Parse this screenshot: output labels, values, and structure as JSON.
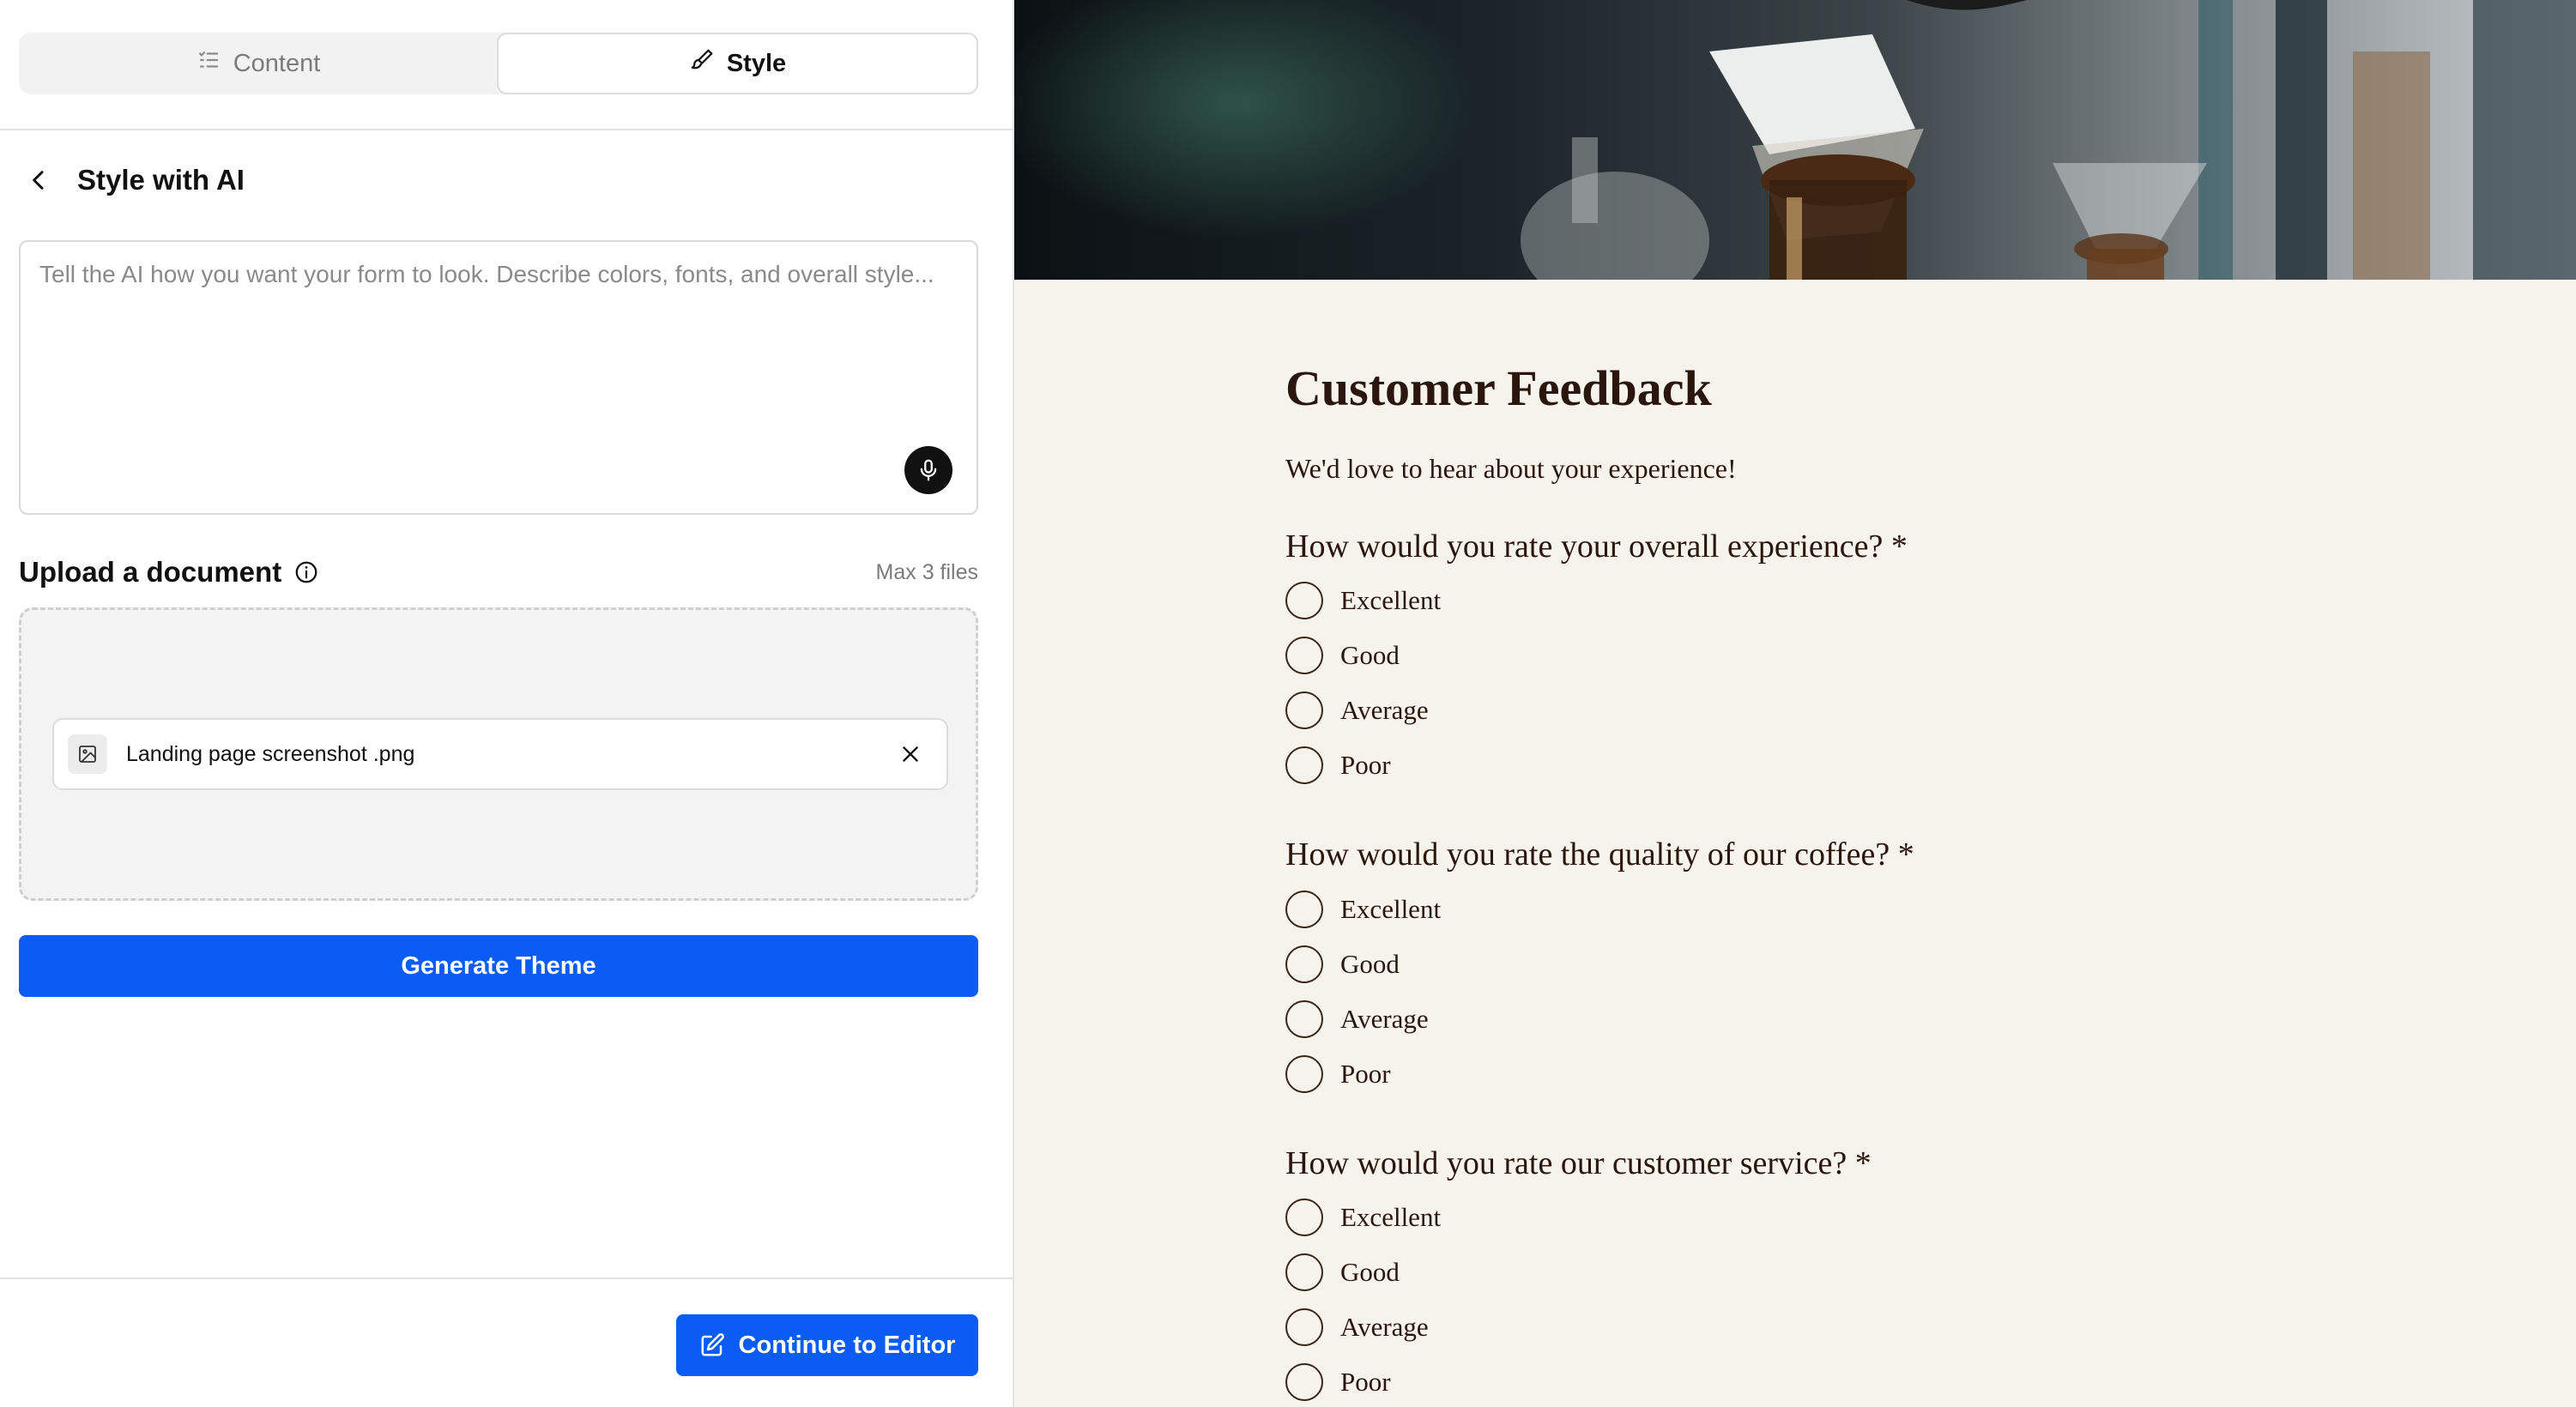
{
  "tabs": [
    {
      "label": "Content",
      "icon": "list-icon",
      "active": false
    },
    {
      "label": "Style",
      "icon": "brush-icon",
      "active": true
    }
  ],
  "panel": {
    "title": "Style with AI",
    "prompt_placeholder": "Tell the AI how you want your form to look. Describe colors, fonts, and overall style...",
    "prompt_value": ""
  },
  "upload": {
    "label": "Upload a document",
    "max_files": "Max 3 files",
    "files": [
      {
        "name": "Landing page screenshot .png",
        "icon": "image-icon"
      }
    ]
  },
  "actions": {
    "generate_label": "Generate Theme",
    "continue_label": "Continue to Editor"
  },
  "colors": {
    "accent": "#0a5cf5",
    "preview_background": "#f6f2ec",
    "preview_text": "#2a160c"
  },
  "preview": {
    "title": "Customer Feedback",
    "subtitle": "We'd love to hear about your experience!",
    "questions": [
      {
        "label": "How would you rate your overall experience? *",
        "options": [
          "Excellent",
          "Good",
          "Average",
          "Poor"
        ]
      },
      {
        "label": "How would you rate the quality of our coffee? *",
        "options": [
          "Excellent",
          "Good",
          "Average",
          "Poor"
        ]
      },
      {
        "label": "How would you rate our customer service? *",
        "options": [
          "Excellent",
          "Good",
          "Average",
          "Poor"
        ]
      }
    ]
  }
}
